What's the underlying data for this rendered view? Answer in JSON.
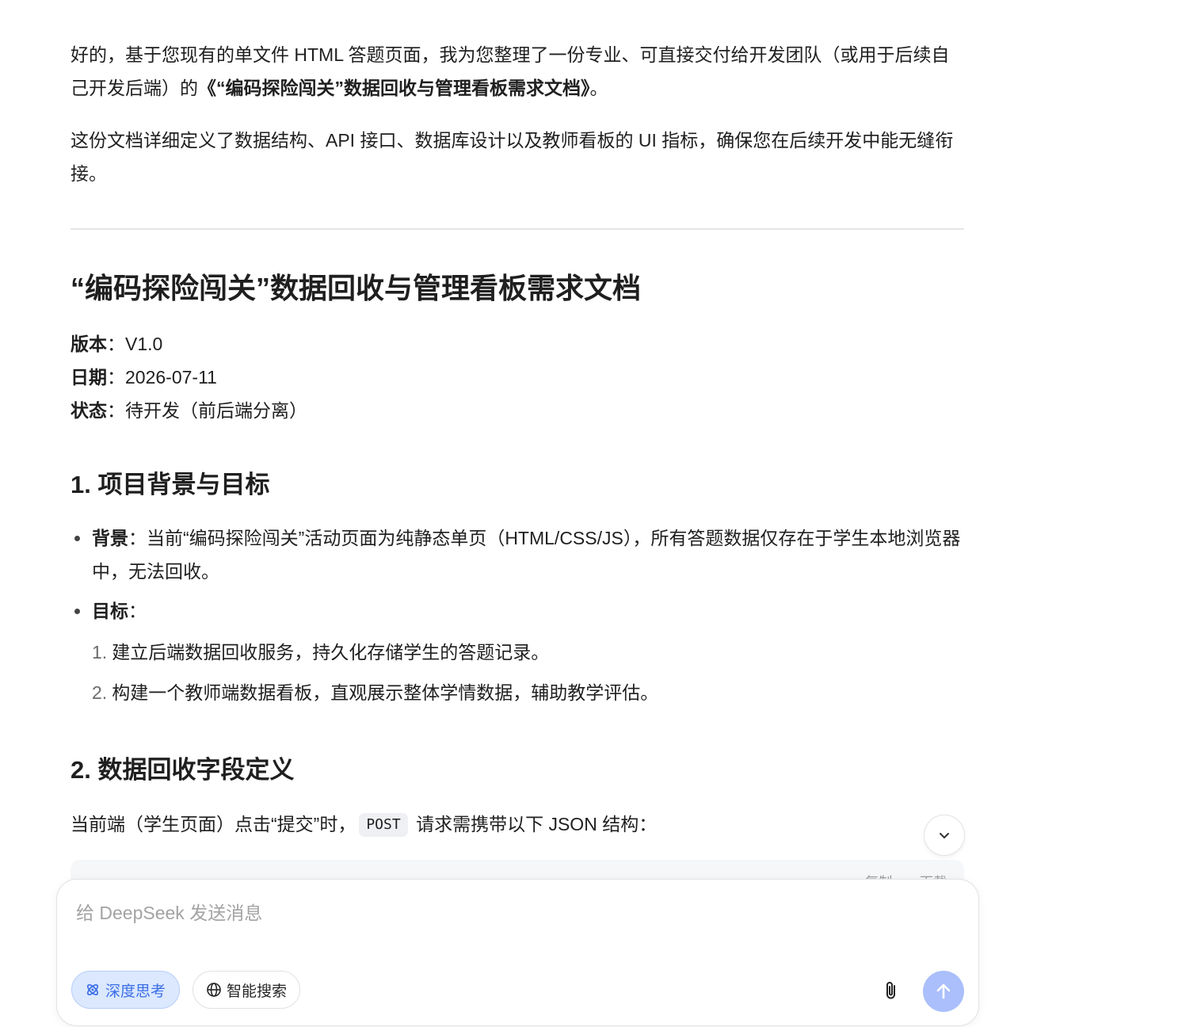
{
  "intro": {
    "p1_text": "好的，基于您现有的单文件 HTML 答题页面，我为您整理了一份专业、可直接交付给开发团队（或用于后续自己开发后端）的",
    "p1_bold": "《“编码探险闯关”数据回收与管理看板需求文档》",
    "p1_end": "。",
    "p2": "这份文档详细定义了数据结构、API 接口、数据库设计以及教师看板的 UI 指标，确保您在后续开发中能无缝衔接。"
  },
  "doc": {
    "title": "“编码探险闯关”数据回收与管理看板需求文档",
    "meta": [
      {
        "label": "版本",
        "sep": "：",
        "value": "V1.0"
      },
      {
        "label": "日期",
        "sep": "：",
        "value": "2026-07-11"
      },
      {
        "label": "状态",
        "sep": "：",
        "value": "待开发（前后端分离）"
      }
    ]
  },
  "section1": {
    "heading": "1. 项目背景与目标",
    "background_label": "背景",
    "background_text": "：当前“编码探险闯关”活动页面为纯静态单页（HTML/CSS/JS），所有答题数据仅存在于学生本地浏览器中，无法回收。",
    "goal_label": "目标",
    "goal_sep": "：",
    "goals": [
      {
        "num": "1.",
        "text": "建立后端数据回收服务，持久化存储学生的答题记录。"
      },
      {
        "num": "2.",
        "text": "构建一个教师端数据看板，直观展示整体学情数据，辅助教学评估。"
      }
    ]
  },
  "section2": {
    "heading": "2. 数据回收字段定义",
    "line_before": "当前端（学生页面）点击“提交”时，",
    "code": "POST",
    "line_after": " 请求需携带以下 JSON 结构：",
    "code_actions": [
      "复制",
      "下载"
    ]
  },
  "composer": {
    "placeholder": "给 DeepSeek 发送消息",
    "deep_think_label": "深度思考",
    "web_search_label": "智能搜索"
  },
  "colors": {
    "accent": "#3b6ee6",
    "send_button": "#aabffb",
    "pill_active_bg": "#dbe8fe"
  }
}
